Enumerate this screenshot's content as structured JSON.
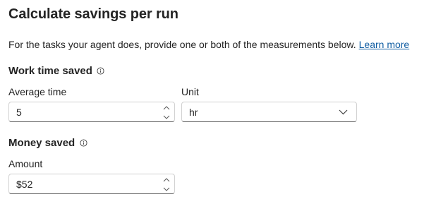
{
  "page": {
    "title": "Calculate savings per run",
    "description": "For the tasks your agent does, provide one or both of the measurements below.",
    "learn_more_label": "Learn more"
  },
  "work_time": {
    "heading": "Work time saved",
    "average_time_label": "Average time",
    "average_time_value": "5",
    "unit_label": "Unit",
    "unit_value": "hr"
  },
  "money": {
    "heading": "Money saved",
    "amount_label": "Amount",
    "amount_value": "$52"
  },
  "icons": {
    "info": "info-icon",
    "spin_up": "chevron-up-icon",
    "spin_down": "chevron-down-icon",
    "dropdown": "chevron-down-icon"
  },
  "colors": {
    "link": "#115ea3",
    "text": "#242424",
    "border": "#d1d1d1"
  }
}
